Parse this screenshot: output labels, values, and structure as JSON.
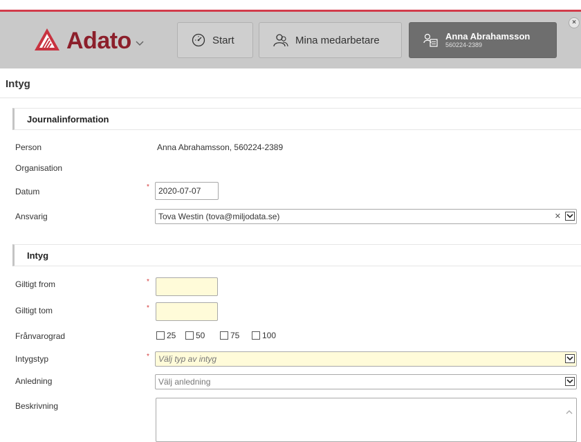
{
  "header": {
    "logo_text": "Adato",
    "start_label": "Start",
    "mina_label": "Mina medarbetare",
    "person_name": "Anna Abrahamsson",
    "person_id": "560224-2389",
    "close_symbol": "×",
    "brand_color": "#8c1f2b",
    "accent_color": "#d23c4a"
  },
  "page": {
    "title": "Intyg"
  },
  "journal": {
    "heading": "Journalinformation",
    "person_label": "Person",
    "person_value": "Anna Abrahamsson, 560224-2389",
    "org_label": "Organisation",
    "datum_label": "Datum",
    "datum_value": "2020-07-07",
    "ansvarig_label": "Ansvarig",
    "ansvarig_value": "Tova Westin (tova@miljodata.se)"
  },
  "intyg": {
    "heading": "Intyg",
    "from_label": "Giltigt from",
    "tom_label": "Giltigt tom",
    "franvaro_label": "Frånvarograd",
    "franvaro_options": [
      "25",
      "50",
      "75",
      "100"
    ],
    "typ_label": "Intygstyp",
    "typ_placeholder": "Välj typ av intyg",
    "anledning_label": "Anledning",
    "anledning_placeholder": "Välj anledning",
    "beskrivning_label": "Beskrivning"
  },
  "required_marker": "*"
}
